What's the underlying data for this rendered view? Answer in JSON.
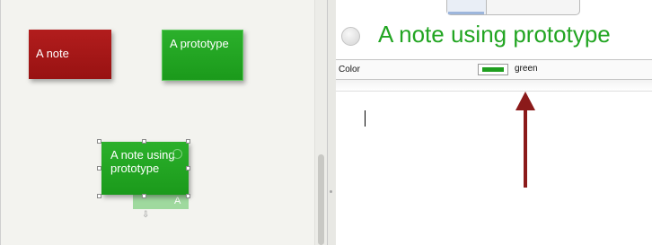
{
  "canvas": {
    "notes": [
      {
        "label": "A note",
        "color": "#a51717"
      },
      {
        "label": "A prototype",
        "color": "#22a522"
      }
    ],
    "selected_note": {
      "label": "A note using prototype",
      "color": "#22a522"
    },
    "ghost_note": {
      "label": "A"
    }
  },
  "inspector": {
    "title": "A note using prototype",
    "title_color": "#22a522",
    "property": {
      "name": "Color",
      "value": "green",
      "swatch": "#1f9e1f"
    }
  },
  "annotation": {
    "arrow_color": "#8b1a1a"
  }
}
